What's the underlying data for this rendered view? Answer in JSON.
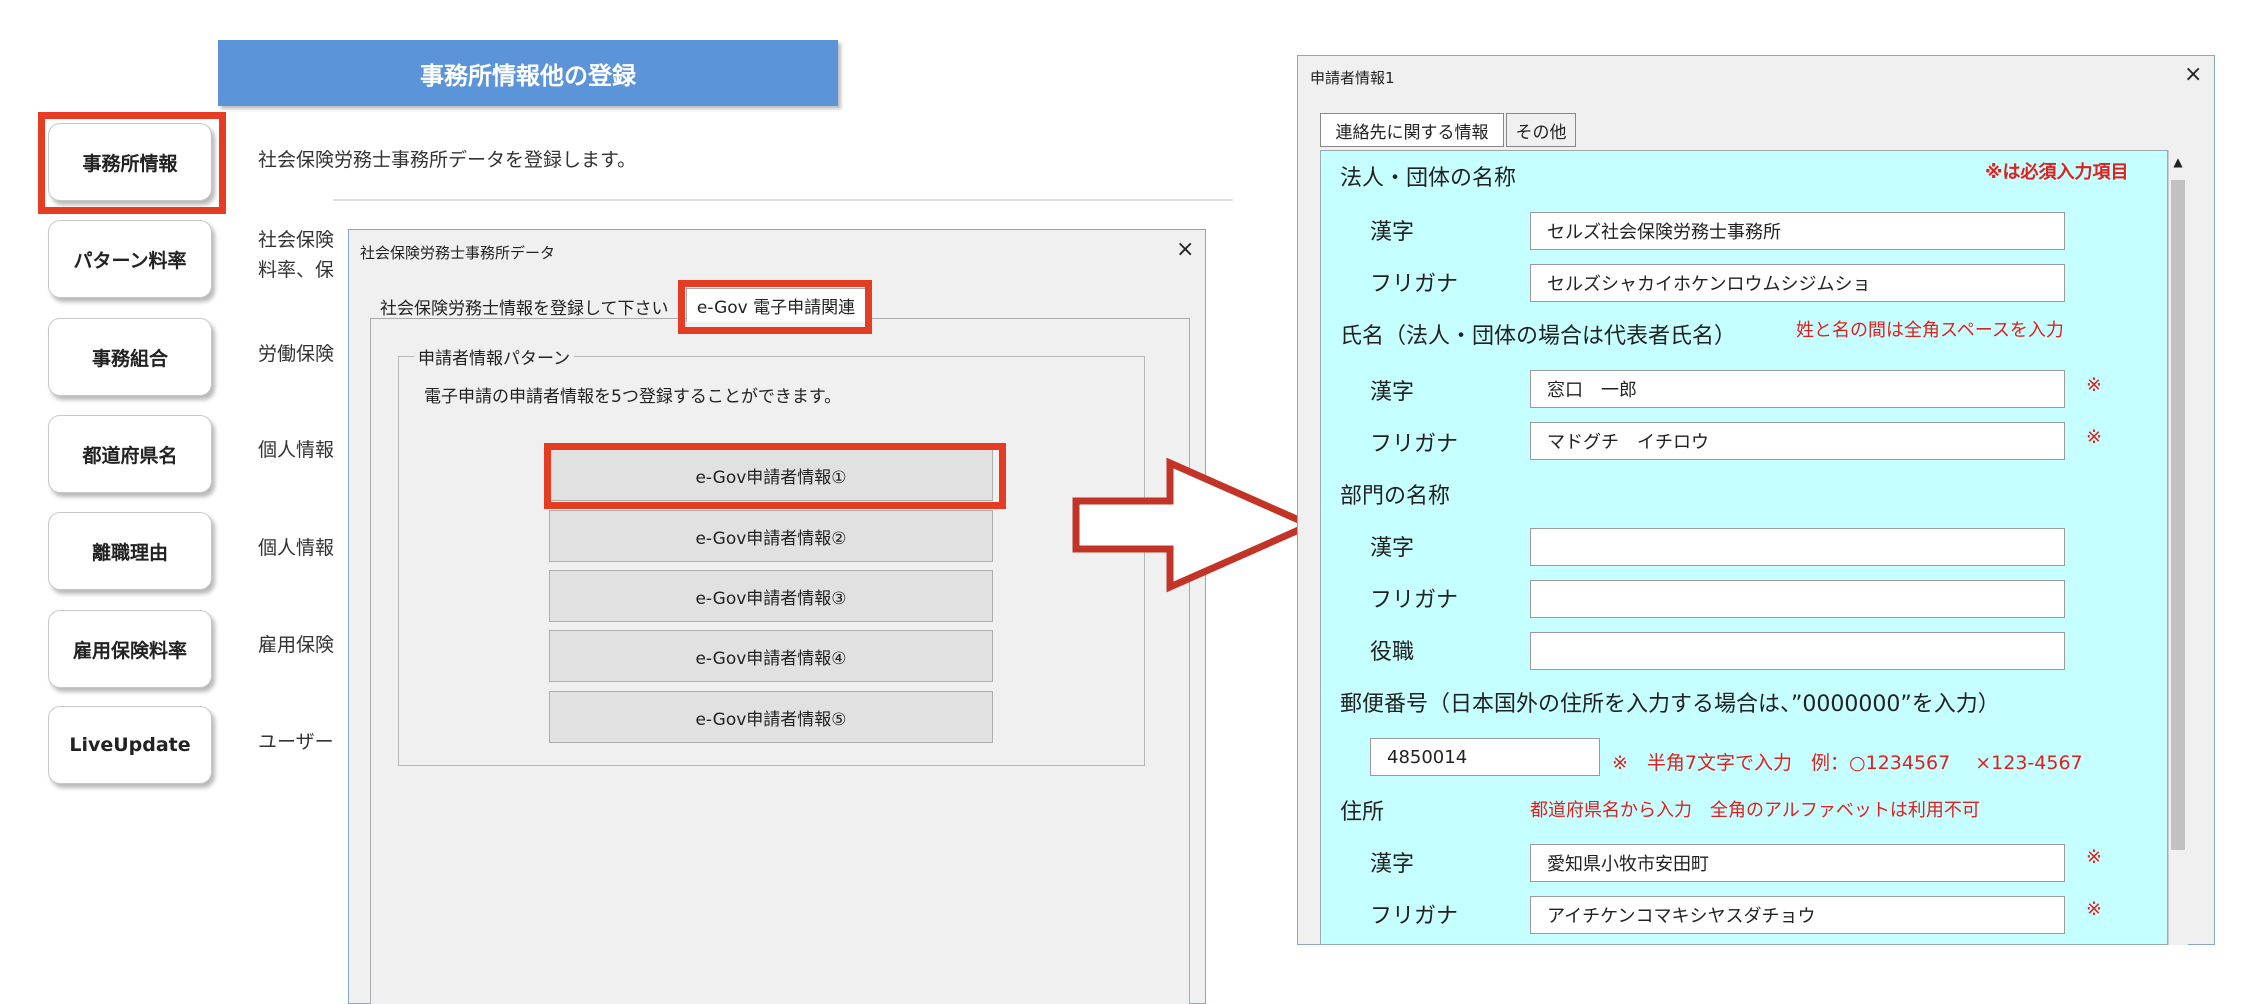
{
  "menu": {
    "banner_title": "事務所情報他の登録",
    "items": [
      {
        "label": "事務所情報",
        "desc": "社会保険労務士事務所データを登録します。"
      },
      {
        "label": "パターン料率",
        "desc": "社会保険",
        "desc2": "料率、保"
      },
      {
        "label": "事務組合",
        "desc": "労働保険"
      },
      {
        "label": "都道府県名",
        "desc": "個人情報"
      },
      {
        "label": "離職理由",
        "desc": "個人情報"
      },
      {
        "label": "雇用保険料率",
        "desc": "雇用保険"
      },
      {
        "label": "LiveUpdate",
        "desc": "ユーザー"
      }
    ]
  },
  "office_dialog": {
    "title": "社会保険労務士事務所データ",
    "tabs": [
      "社会保険労務士情報を登録して下さい",
      "e-Gov 電子申請関連"
    ],
    "group_label": "申請者情報パターン",
    "group_desc": "電子申請の申請者情報を5つ登録することができます。",
    "buttons": [
      "e-Gov申請者情報①",
      "e-Gov申請者情報②",
      "e-Gov申請者情報③",
      "e-Gov申請者情報④",
      "e-Gov申請者情報⑤"
    ]
  },
  "applicant_dialog": {
    "title": "申請者情報1",
    "tabs": [
      "連絡先に関する情報",
      "その他"
    ],
    "required_note": "※は必須入力項目",
    "required_mark": "※",
    "kanji_label": "漢字",
    "furigana_label": "フリガナ",
    "corp": {
      "heading": "法人・団体の名称",
      "kanji": "セルズ社会保険労務士事務所",
      "furigana": "セルズシャカイホケンロウムシジムショ"
    },
    "name": {
      "heading": "氏名（法人・団体の場合は代表者氏名）",
      "note": "姓と名の間は全角スペースを入力",
      "kanji": "窓口　一郎",
      "furigana": "マドグチ　イチロウ"
    },
    "dept": {
      "heading": "部門の名称",
      "kanji": "",
      "furigana": "",
      "title_label": "役職",
      "title": ""
    },
    "postal": {
      "heading": "郵便番号（日本国外の住所を入力する場合は、”0000000”を入力）",
      "value": "4850014",
      "note": "※　半角7文字で入力　例：○1234567　 ×123-4567"
    },
    "address": {
      "heading": "住所",
      "note": "都道府県名から入力　全角のアルファベットは利用不可",
      "kanji": "愛知県小牧市安田町",
      "furigana": "アイチケンコマキシヤスダチョウ"
    },
    "close": "×"
  },
  "colors": {
    "highlight": "#e43d24",
    "banner": "#5b94d8",
    "panel": "#c6ffff",
    "note_red": "#e02020"
  }
}
